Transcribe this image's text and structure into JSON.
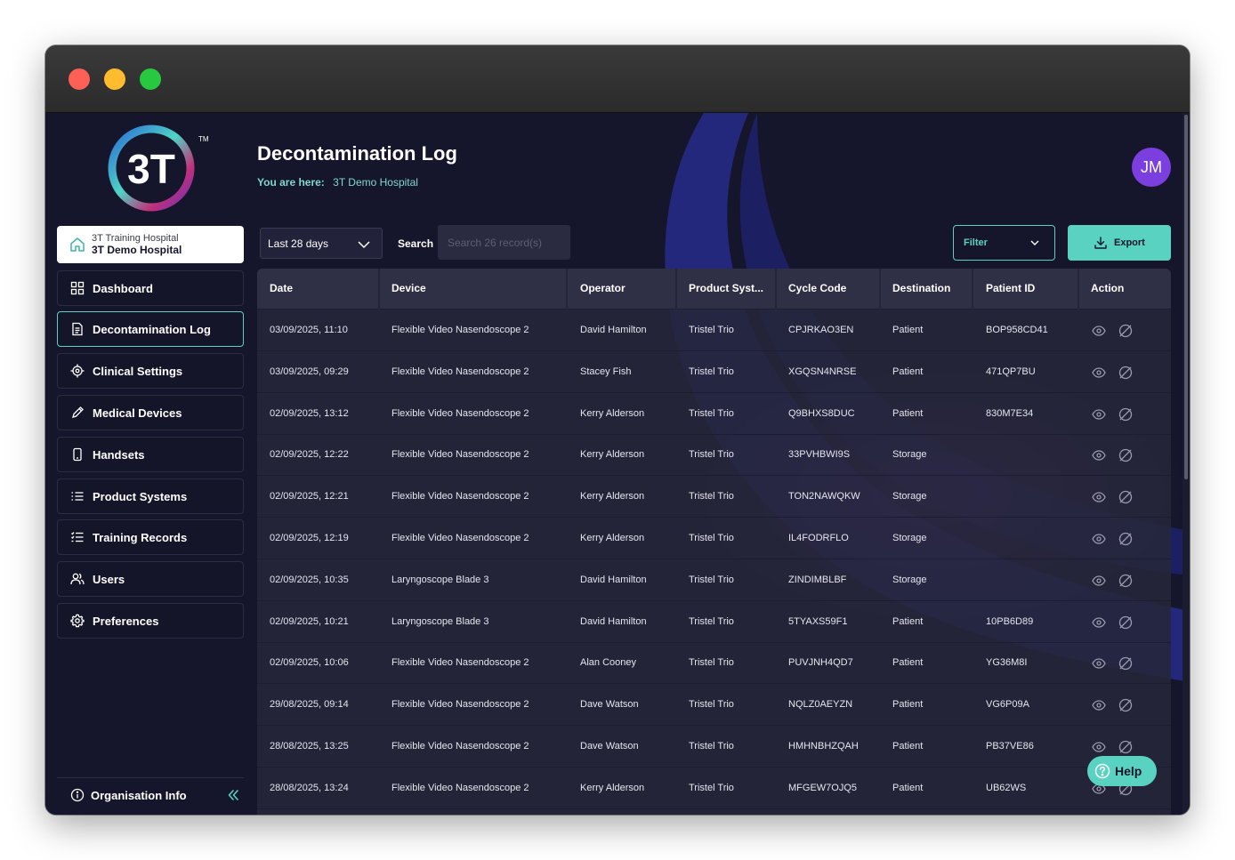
{
  "sidebar": {
    "org_parent": "3T Training Hospital",
    "org_name": "3T Demo Hospital",
    "items": [
      {
        "label": "Dashboard",
        "icon": "grid-icon"
      },
      {
        "label": "Decontamination Log",
        "icon": "document-icon",
        "active": true
      },
      {
        "label": "Clinical Settings",
        "icon": "target-icon"
      },
      {
        "label": "Medical Devices",
        "icon": "pen-icon"
      },
      {
        "label": "Handsets",
        "icon": "phone-icon"
      },
      {
        "label": "Product Systems",
        "icon": "list-icon"
      },
      {
        "label": "Training Records",
        "icon": "checklist-icon"
      },
      {
        "label": "Users",
        "icon": "users-icon"
      },
      {
        "label": "Preferences",
        "icon": "gear-icon"
      }
    ],
    "footer_label": "Organisation Info"
  },
  "header": {
    "title": "Decontamination Log",
    "breadcrumb_prefix": "You are here:",
    "breadcrumb_current": "3T Demo Hospital",
    "avatar_initials": "JM"
  },
  "toolbar": {
    "date_range": "Last 28 days",
    "search_label": "Search",
    "search_placeholder": "Search 26 record(s)",
    "filter_label": "Filter",
    "export_label": "Export"
  },
  "table": {
    "columns": [
      "Date",
      "Device",
      "Operator",
      "Product Syst...",
      "Cycle Code",
      "Destination",
      "Patient ID",
      "Action"
    ],
    "rows": [
      [
        "03/09/2025, 11:10",
        "Flexible Video Nasendoscope 2",
        "David Hamilton",
        "Tristel Trio",
        "CPJRKAO3EN",
        "Patient",
        "BOP958CD41"
      ],
      [
        "03/09/2025, 09:29",
        "Flexible Video Nasendoscope 2",
        "Stacey Fish",
        "Tristel Trio",
        "XGQSN4NRSE",
        "Patient",
        "471QP7BU"
      ],
      [
        "02/09/2025, 13:12",
        "Flexible Video Nasendoscope 2",
        "Kerry Alderson",
        "Tristel Trio",
        "Q9BHXS8DUC",
        "Patient",
        "830M7E34"
      ],
      [
        "02/09/2025, 12:22",
        "Flexible Video Nasendoscope 2",
        "Kerry Alderson",
        "Tristel Trio",
        "33PVHBWI9S",
        "Storage",
        ""
      ],
      [
        "02/09/2025, 12:21",
        "Flexible Video Nasendoscope 2",
        "Kerry Alderson",
        "Tristel Trio",
        "TON2NAWQKW",
        "Storage",
        ""
      ],
      [
        "02/09/2025, 12:19",
        "Flexible Video Nasendoscope 2",
        "Kerry Alderson",
        "Tristel Trio",
        "IL4FODRFLO",
        "Storage",
        ""
      ],
      [
        "02/09/2025, 10:35",
        "Laryngoscope Blade 3",
        "David Hamilton",
        "Tristel Trio",
        "ZINDIMBLBF",
        "Storage",
        ""
      ],
      [
        "02/09/2025, 10:21",
        "Laryngoscope Blade 3",
        "David Hamilton",
        "Tristel Trio",
        "5TYAXS59F1",
        "Patient",
        "10PB6D89"
      ],
      [
        "02/09/2025, 10:06",
        "Flexible Video Nasendoscope 2",
        "Alan Cooney",
        "Tristel Trio",
        "PUVJNH4QD7",
        "Patient",
        "YG36M8I"
      ],
      [
        "29/08/2025, 09:14",
        "Flexible Video Nasendoscope 2",
        "Dave Watson",
        "Tristel Trio",
        "NQLZ0AEYZN",
        "Patient",
        "VG6P09A"
      ],
      [
        "28/08/2025, 13:25",
        "Flexible Video Nasendoscope 2",
        "Dave Watson",
        "Tristel Trio",
        "HMHNBHZQAH",
        "Patient",
        "PB37VE86"
      ],
      [
        "28/08/2025, 13:24",
        "Flexible Video Nasendoscope 2",
        "Kerry Alderson",
        "Tristel Trio",
        "MFGEW7OJQ5",
        "Patient",
        "UB62WS"
      ]
    ]
  },
  "help_label": "Help",
  "colors": {
    "accent": "#5ad2c2",
    "background": "#15162b",
    "avatar": "#7b3fe0"
  }
}
